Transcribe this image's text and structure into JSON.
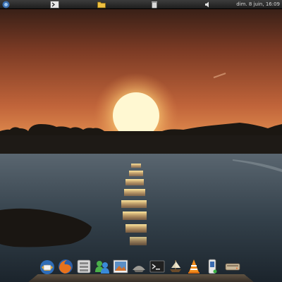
{
  "desktop": {
    "wallpaper": "sunset-over-sea",
    "colors": {
      "sky_top": "#3a1f14",
      "sky_mid": "#b45a35",
      "horizon": "#e08a4e",
      "sun": "#fff3b0",
      "water": "#3f4d57"
    }
  },
  "top_panel": {
    "icons": [
      "menu-icon",
      "terminal-icon",
      "folder-icon",
      "trash-icon",
      "volume-icon"
    ],
    "clock": "dim. 8 juin, 16:09"
  },
  "dock": {
    "items": [
      "thunderbird-icon",
      "firefox-icon",
      "file-manager-icon",
      "messenger-icon",
      "photo-viewer-icon",
      "shell-icon",
      "terminal-icon",
      "ship-icon",
      "vlc-icon",
      "phone-icon",
      "drive-icon"
    ]
  }
}
